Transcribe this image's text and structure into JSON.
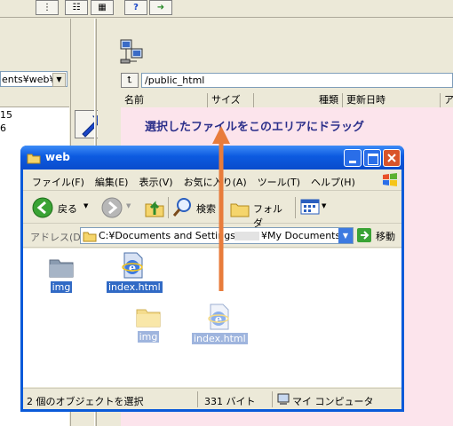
{
  "bg_explorer": {
    "path_fragment": "ents¥web¥",
    "list_values": [
      "15",
      "6"
    ]
  },
  "ftp_pane": {
    "remote_path": "/public_html",
    "columns": [
      "名前",
      "サイズ",
      "種類",
      "更新日時",
      "ア"
    ],
    "drop_hint": "選択したファイルをこのエリアにドラッグ"
  },
  "explorer": {
    "title": "web",
    "menu": [
      "ファイル(F)",
      "編集(E)",
      "表示(V)",
      "お気に入り(A)",
      "ツール(T)",
      "ヘルプ(H)"
    ],
    "toolbar": {
      "back": "戻る",
      "search": "検索",
      "folders": "フォルダ"
    },
    "address_label": "アドレス(D)",
    "address_value": "C:¥Documents and Settings¥",
    "address_value_tail": "¥My Documents¥v",
    "go_label": "移動",
    "files": [
      {
        "name": "img",
        "icon": "folder-icon"
      },
      {
        "name": "index.html",
        "icon": "ie-document-icon"
      }
    ],
    "drag_ghosts": [
      {
        "name": "img",
        "icon": "folder-icon"
      },
      {
        "name": "index.html",
        "icon": "ie-document-icon"
      }
    ],
    "status": {
      "selection": "2 個のオブジェクトを選択",
      "size": "331 バイト",
      "location": "マイ コンピュータ"
    }
  },
  "colors": {
    "xp_blue": "#0a5ad9",
    "selection": "#316ac5",
    "ftp_bg": "#fce4ec",
    "drag_arrow": "#e87c3b",
    "close_red": "#d9542a"
  }
}
